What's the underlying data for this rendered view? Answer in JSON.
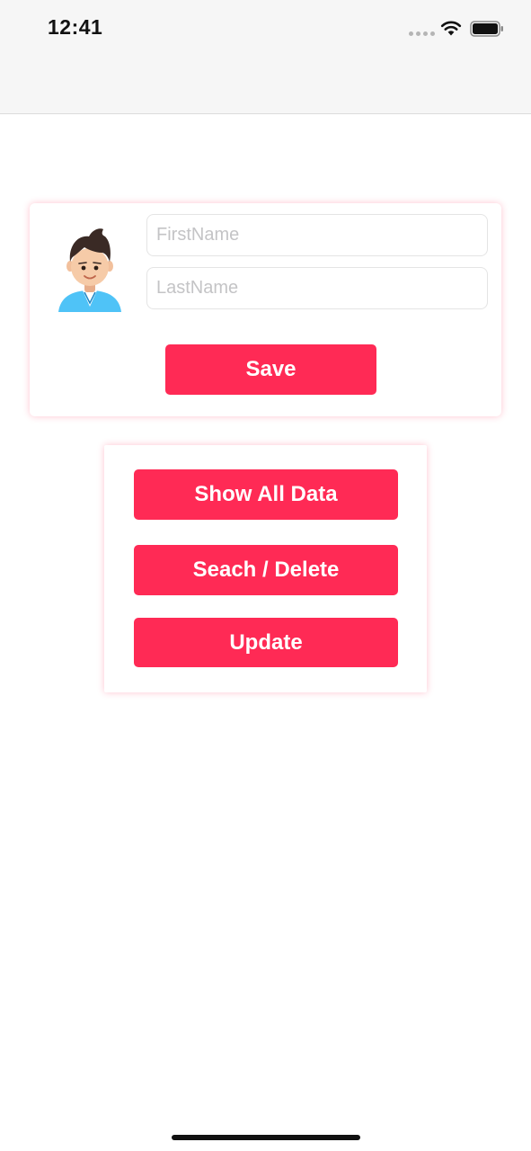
{
  "status_bar": {
    "time": "12:41",
    "icons": [
      "signal-dots-icon",
      "wifi-icon",
      "battery-icon"
    ]
  },
  "form": {
    "avatar_icon": "user-avatar-icon",
    "first_name": {
      "value": "",
      "placeholder": "FirstName"
    },
    "last_name": {
      "value": "",
      "placeholder": "LastName"
    },
    "save_label": "Save"
  },
  "actions": {
    "show_all_label": "Show All Data",
    "search_delete_label": "Seach / Delete",
    "update_label": "Update"
  },
  "colors": {
    "accent": "#ff2a55",
    "nav_background": "#f6f6f6",
    "field_border": "#e4e4e4",
    "placeholder": "#c4c4c6"
  }
}
